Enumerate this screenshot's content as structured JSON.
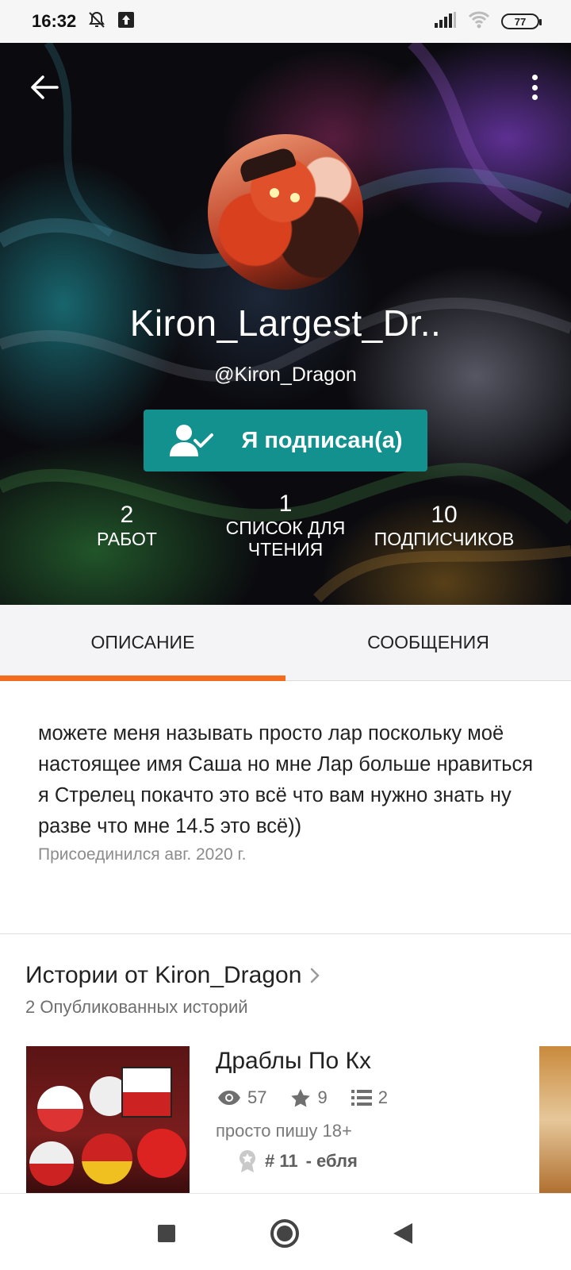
{
  "status_bar": {
    "time": "16:32",
    "battery": "77",
    "icons": [
      "bell-off-icon",
      "upload-icon",
      "signal-icon",
      "wifi-icon",
      "battery-icon"
    ]
  },
  "profile": {
    "display_name": "Kiron_Largest_Dr..",
    "username": "@Kiron_Dragon",
    "follow_label": "Я подписан(а)",
    "stats": [
      {
        "value": "2",
        "label": "РАБОТ"
      },
      {
        "value": "1",
        "label": "СПИСОК ДЛЯ ЧТЕНИЯ"
      },
      {
        "value": "10",
        "label": "ПОДПИСЧИКОВ"
      }
    ],
    "colors": {
      "follow_button": "#12918f",
      "tab_indicator": "#f36c1d"
    }
  },
  "tabs": [
    {
      "label": "ОПИСАНИЕ",
      "active": true
    },
    {
      "label": "СООБЩЕНИЯ",
      "active": false
    }
  ],
  "about": {
    "description": "можете меня называть просто лар поскольку моё настоящее имя Саша но мне Лар больше нравиться я Стрелец покачто это всё что вам нужно знать ну разве что мне 14.5 это всё))",
    "joined": "Присоединился авг. 2020 г."
  },
  "stories": {
    "title": "Истории от Kiron_Dragon",
    "subtitle": "2 Опубликованных историй",
    "items": [
      {
        "title": "Драблы По Кх",
        "views": "57",
        "votes": "9",
        "parts": "2",
        "description": "просто пишу 18+",
        "rank": "# 11",
        "rank_tag": "- ебля"
      }
    ]
  },
  "nav": {
    "icons": [
      "recents-square-icon",
      "home-circle-icon",
      "back-triangle-icon"
    ]
  }
}
